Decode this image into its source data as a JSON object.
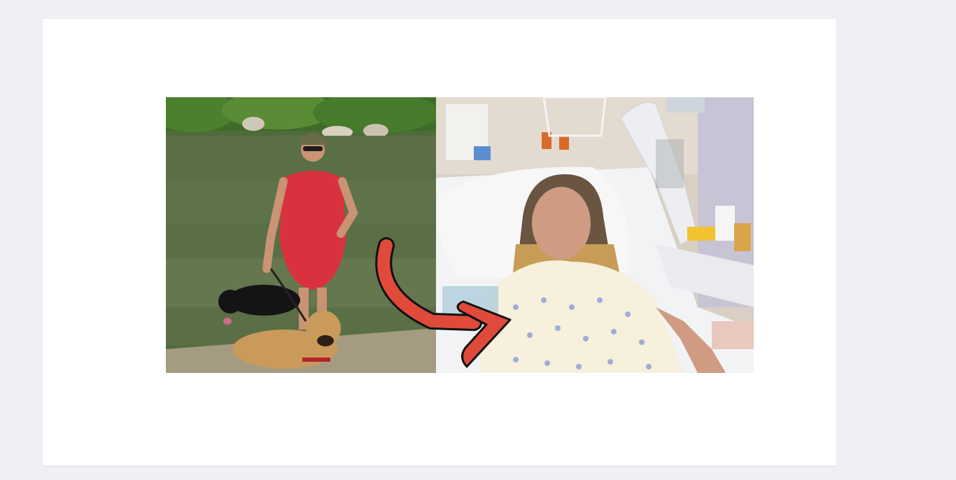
{
  "image": {
    "description_icon": "before-after-photo-icon"
  },
  "colors": {
    "page_background": "#eef0f4",
    "card_background": "#ffffff",
    "arrow": "#e04a3b"
  }
}
